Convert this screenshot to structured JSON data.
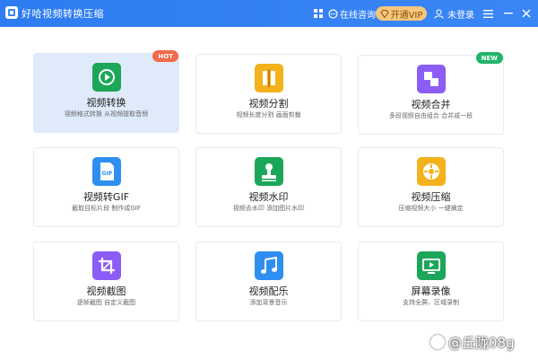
{
  "app": {
    "title": "好哈视频转换压缩"
  },
  "toolbar": {
    "chat": "在线咨询",
    "vip": "开通VIP",
    "user": "未登录"
  },
  "cards": [
    {
      "title": "视频转换",
      "desc": "视频格式转换 从视频提取音频",
      "badge": "HOT",
      "color": "#1ba65a",
      "icon": "convert-icon"
    },
    {
      "title": "视频分割",
      "desc": "视频长度分割 画面剪裁",
      "badge": "",
      "color": "#f3b21b",
      "icon": "split-icon"
    },
    {
      "title": "视频合并",
      "desc": "多段视频自由组合 合并成一段",
      "badge": "NEW",
      "color": "#8b5cf6",
      "icon": "merge-icon"
    },
    {
      "title": "视频转GIF",
      "desc": "截取目标片段 制作成GIF",
      "badge": "",
      "color": "#2f8ff0",
      "icon": "gif-icon"
    },
    {
      "title": "视频水印",
      "desc": "视频去水印 添加图片水印",
      "badge": "",
      "color": "#1ba65a",
      "icon": "stamp-icon"
    },
    {
      "title": "视频压缩",
      "desc": "压缩视频大小 一键搞定",
      "badge": "",
      "color": "#f3b21b",
      "icon": "compress-icon"
    },
    {
      "title": "视频截图",
      "desc": "逐帧截图 自定义截图",
      "badge": "",
      "color": "#8b5cf6",
      "icon": "crop-icon"
    },
    {
      "title": "视频配乐",
      "desc": "添加背景音乐",
      "badge": "",
      "color": "#2f8ff0",
      "icon": "music-icon"
    },
    {
      "title": "屏幕录像",
      "desc": "支持全屏、区域录制",
      "badge": "",
      "color": "#1ba65a",
      "icon": "screen-record-icon"
    }
  ],
  "watermark": "@丘陇08g"
}
